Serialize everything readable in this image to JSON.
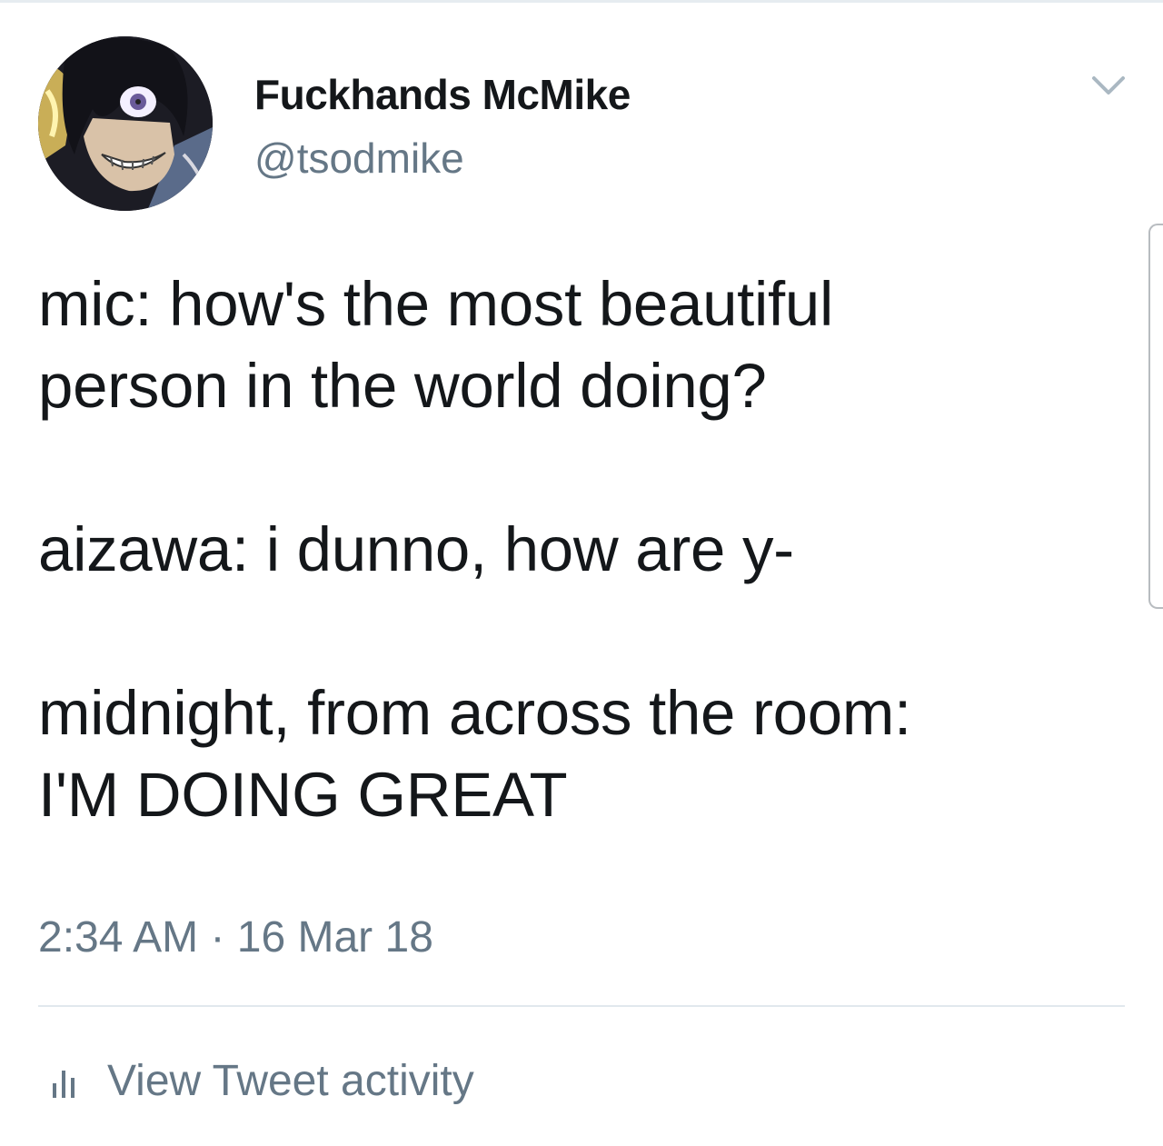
{
  "tweet": {
    "display_name": "Fuckhands McMike",
    "handle": "@tsodmike",
    "text": "mic: how's the most beautiful\nperson in the world doing?\n\naizawa: i dunno, how are y-\n\nmidnight, from across the room:\nI'M DOING GREAT",
    "timestamp": "2:34 AM · 16 Mar 18"
  },
  "footer": {
    "activity_label": "View Tweet activity"
  },
  "icons": {
    "menu": "chevron-down-icon",
    "activity": "bar-chart-icon"
  },
  "colors": {
    "text_primary": "#14171a",
    "text_secondary": "#657786",
    "divider": "#e1e8ed"
  }
}
